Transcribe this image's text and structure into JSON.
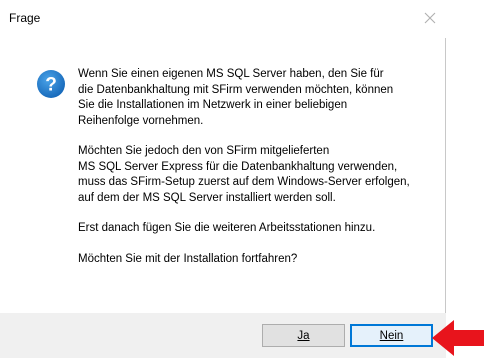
{
  "window": {
    "title": "Frage"
  },
  "icons": {
    "close": "close-icon",
    "question": "question-icon",
    "arrow": "red-arrow-icon"
  },
  "message": {
    "p1": "Wenn Sie einen eigenen MS SQL Server haben, den Sie für\ndie Datenbankhaltung mit SFirm verwenden möchten, können\nSie die Installationen im Netzwerk in einer beliebigen\nReihenfolge vornehmen.",
    "p2": "Möchten Sie jedoch den von SFirm mitgelieferten\nMS SQL Server Express für die Datenbankhaltung verwenden,\nmuss das SFirm-Setup zuerst auf dem Windows-Server erfolgen,\nauf dem der MS SQL Server installiert werden soll.",
    "p3": "Erst danach fügen Sie die weiteren Arbeitsstationen hinzu.",
    "p4": "Möchten Sie mit der Installation fortfahren?"
  },
  "buttons": {
    "yes": "Ja",
    "no": "Nein"
  },
  "colors": {
    "accent": "#0078d7",
    "arrow": "#e8141c",
    "footer": "#f0f0f0"
  }
}
